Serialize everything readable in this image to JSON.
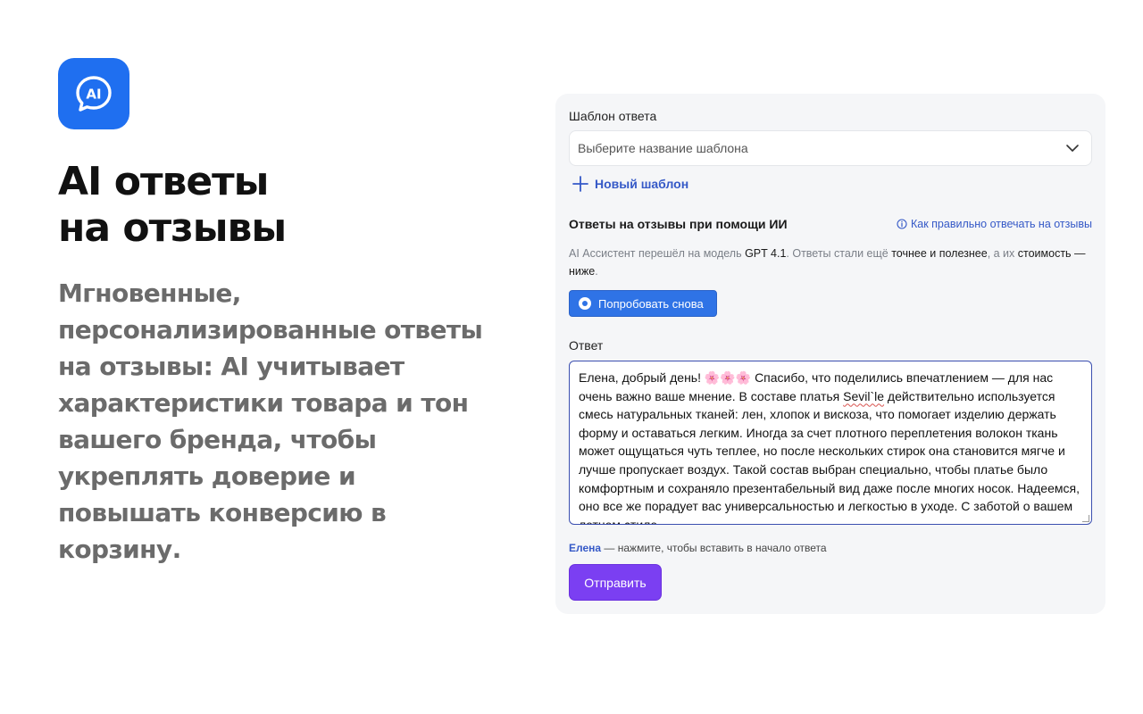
{
  "promo": {
    "logo_text": "AI",
    "headline_line1": "AI ответы",
    "headline_line2": "на отзывы",
    "subtext": "Мгновенные, персонализированные ответы на отзывы: AI учитывает характеристики товара и тон вашего бренда, чтобы укреплять доверие и повышать конверсию в корзину."
  },
  "panel": {
    "template_label": "Шаблон ответа",
    "template_select_placeholder": "Выберите название шаблона",
    "new_template_label": "Новый шаблон",
    "ai_section_title": "Ответы на отзывы при помощи ИИ",
    "help_link_label": "Как правильно отвечать на отзывы",
    "notice_part1": "AI Ассистент перешёл на модель ",
    "notice_model": "GPT 4.1",
    "notice_part2": ". Ответы стали ещё ",
    "notice_highlight": "точнее и полезнее",
    "notice_part3": ", а их ",
    "notice_cost": "стоимость — ниже",
    "notice_end": ".",
    "retry_button_label": "Попробовать снова",
    "answer_label": "Ответ",
    "answer_text_before": "Елена, добрый день! 🌸🌸🌸 Спасибо, что поделились впечатлением — для нас очень важно ваше мнение. В составе платья ",
    "answer_brand": "Sevil`le",
    "answer_text_after": " действительно используется смесь натуральных тканей: лен, хлопок и вискоза, что помогает изделию держать форму и оставаться легким. Иногда за счет плотного переплетения волокон ткань может ощущаться чуть теплее, но после нескольких стирок она становится мягче и лучше пропускает воздух. Такой состав выбран специально, чтобы платье было комфортным и сохраняло презентабельный вид даже после многих носок. Надеемся, оно все же порадует вас универсальностью и легкостью в уходе. С заботой о вашем летнем стиле,",
    "insert_name": "Елена",
    "insert_hint": " — нажмите, чтобы вставить в начало ответа",
    "send_button_label": "Отправить"
  },
  "colors": {
    "logo_bg": "#1f6ff0",
    "link": "#3559c7",
    "retry_button": "#2f73e6",
    "send_button": "#7b3ff2",
    "panel_bg": "#f5f6f8"
  },
  "icons": [
    "ai-chat-icon",
    "chevron-down-icon",
    "plus-icon",
    "info-icon"
  ]
}
